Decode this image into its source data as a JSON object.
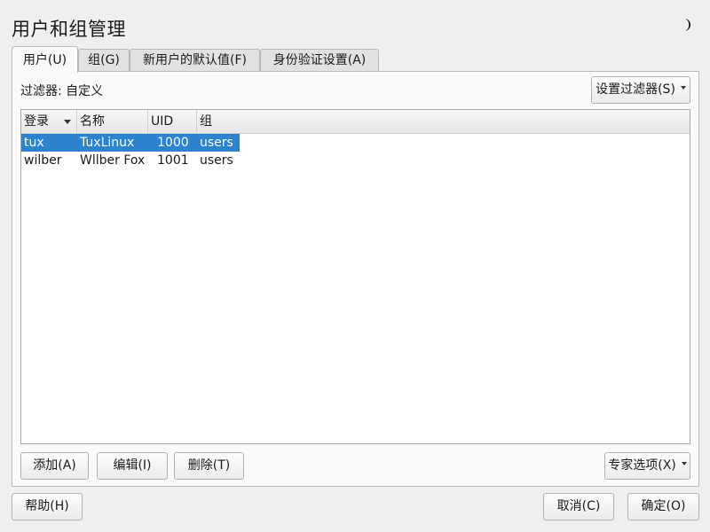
{
  "window": {
    "title": "用户和组管理"
  },
  "tabs": [
    {
      "label": "用户(U)",
      "active": true
    },
    {
      "label": "组(G)",
      "active": false
    },
    {
      "label": "新用户的默认值(F)",
      "active": false
    },
    {
      "label": "身份验证设置(A)",
      "active": false
    }
  ],
  "filter": {
    "label": "过滤器: 自定义",
    "button_label": "设置过滤器(S)"
  },
  "table": {
    "columns": [
      "登录",
      "名称",
      "UID",
      "组"
    ],
    "rows": [
      {
        "login": "tux",
        "name": "TuxLinux",
        "uid": "1000",
        "group": "users",
        "selected": true
      },
      {
        "login": "wilber",
        "name": "Wllber Fox",
        "uid": "1001",
        "group": "users",
        "selected": false
      }
    ]
  },
  "actions": {
    "add_label": "添加(A)",
    "edit_label": "编辑(I)",
    "delete_label": "删除(T)",
    "expert_label": "专家选项(X)"
  },
  "footer": {
    "help_label": "帮助(H)",
    "cancel_label": "取消(C)",
    "ok_label": "确定(O)"
  },
  "colors": {
    "selection": "#2c83d0"
  }
}
